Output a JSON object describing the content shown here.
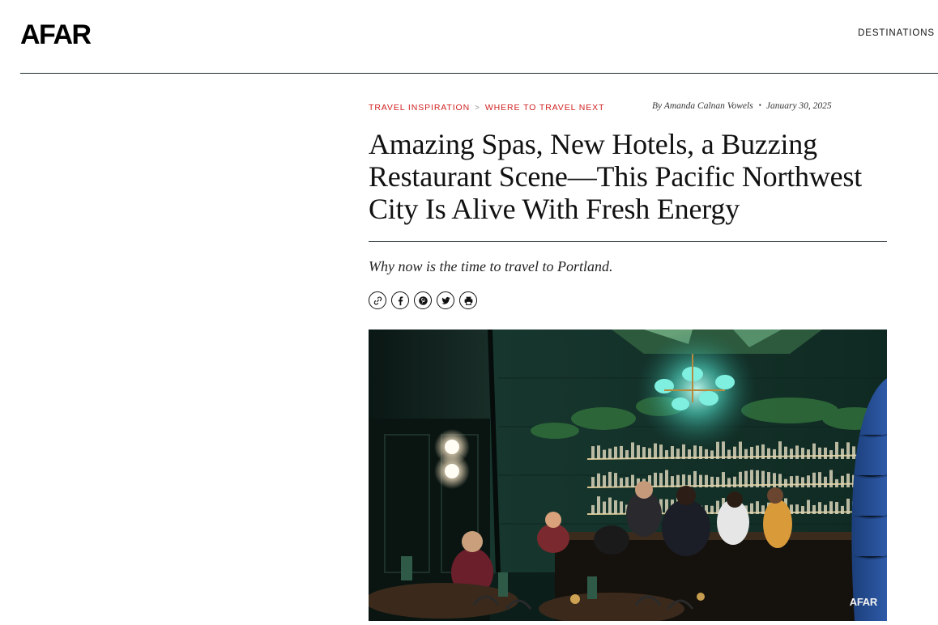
{
  "header": {
    "logo": "AFAR",
    "nav_destinations": "DESTINATIONS"
  },
  "breadcrumb": {
    "items": [
      "TRAVEL INSPIRATION",
      "WHERE TO TRAVEL NEXT"
    ],
    "separator": ">"
  },
  "byline": {
    "prefix": "By",
    "author": "Amanda Calnan Vowels",
    "separator": "•",
    "date": "January 30, 2025"
  },
  "article": {
    "headline_lines": [
      "Amazing Spas, New Hotels, a Buzzing",
      "Restaurant Scene—This Pacific Northwest",
      "City Is Alive With Fresh Energy"
    ],
    "dek": "Why now is the time to travel to Portland."
  },
  "share_icons": [
    "link-icon",
    "facebook-icon",
    "pinterest-icon",
    "twitter-icon",
    "print-icon"
  ],
  "hero": {
    "description_icon": "restaurant-bar-photo",
    "watermark": "AFAR"
  },
  "colors": {
    "accent_red": "#d21f1f",
    "rule": "#1d2b2e",
    "text": "#111111"
  }
}
